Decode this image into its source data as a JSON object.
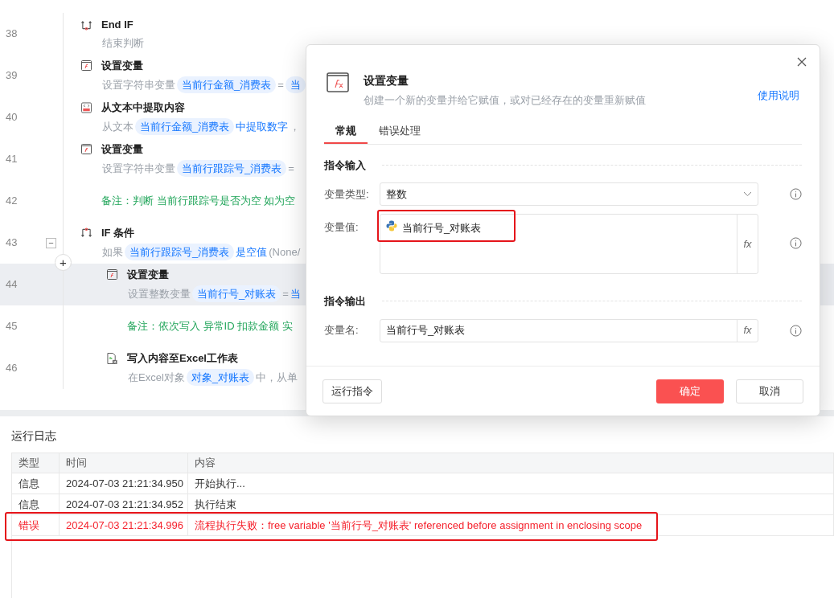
{
  "flow": {
    "add_button": "+",
    "steps": [
      {
        "line": "38",
        "kind": "endif",
        "title": "End IF",
        "selected": false,
        "desc": [
          {
            "kind": "plain",
            "text": "结束判断"
          }
        ]
      },
      {
        "line": "39",
        "kind": "setvar",
        "title": "设置变量",
        "selected": false,
        "desc": [
          {
            "kind": "plain",
            "text": "设置字符串变量"
          },
          {
            "kind": "var",
            "text": "当前行金额_消费表"
          },
          {
            "kind": "plain",
            "text": "="
          },
          {
            "kind": "var",
            "text": "当"
          }
        ]
      },
      {
        "line": "40",
        "kind": "extract",
        "title": "从文本中提取内容",
        "selected": false,
        "desc": [
          {
            "kind": "plain",
            "text": "从文本"
          },
          {
            "kind": "var",
            "text": "当前行金额_消费表"
          },
          {
            "kind": "keyword",
            "text": "中提取数字"
          },
          {
            "kind": "plain",
            "text": "，"
          }
        ]
      },
      {
        "line": "41",
        "kind": "setvar",
        "title": "设置变量",
        "selected": false,
        "desc": [
          {
            "kind": "plain",
            "text": "设置字符串变量"
          },
          {
            "kind": "var",
            "text": "当前行跟踪号_消费表"
          },
          {
            "kind": "plain",
            "text": "="
          }
        ]
      },
      {
        "line": "42",
        "kind": "comment",
        "title": "备注：判断 当前行跟踪号是否为空 如为空",
        "selected": false
      },
      {
        "line": "43",
        "kind": "if",
        "title": "IF 条件",
        "selected": false,
        "expanded": true,
        "collapse_button": "−",
        "desc": [
          {
            "kind": "plain",
            "text": "如果"
          },
          {
            "kind": "var",
            "text": "当前行跟踪号_消费表"
          },
          {
            "kind": "keyword",
            "text": "是空值"
          },
          {
            "kind": "plain",
            "text": "(None/"
          }
        ],
        "children": [
          {
            "line": "44",
            "kind": "setvar",
            "title": "设置变量",
            "selected": true,
            "desc": [
              {
                "kind": "plain",
                "text": "设置整数变量"
              },
              {
                "kind": "var",
                "text": "当前行号_对账表"
              },
              {
                "kind": "plain",
                "text": "="
              },
              {
                "kind": "keyword",
                "text": "当"
              }
            ]
          },
          {
            "line": "45",
            "kind": "comment",
            "title": "备注：依次写入 异常ID 扣款金额 实",
            "selected": false
          },
          {
            "line": "46",
            "kind": "excel",
            "title": "写入内容至Excel工作表",
            "selected": false,
            "desc": [
              {
                "kind": "plain",
                "text": "在Excel对象"
              },
              {
                "kind": "var",
                "text": "对象_对账表"
              },
              {
                "kind": "plain",
                "text": "中，从单"
              }
            ]
          }
        ]
      }
    ]
  },
  "dialog": {
    "title": "设置变量",
    "subtitle": "创建一个新的变量并给它赋值，或对已经存在的变量重新赋值",
    "help_link": "使用说明",
    "tabs": [
      {
        "label": "常规",
        "selected": true
      },
      {
        "label": "错误处理",
        "selected": false
      }
    ],
    "input_section": "指令输入",
    "type_label": "变量类型:",
    "type_value": "整数",
    "value_label": "变量值:",
    "value_token": "当前行号_对账表",
    "value_highlighted": true,
    "output_section": "指令输出",
    "name_label": "变量名:",
    "name_value": "当前行号_对账表",
    "fx_buttons": [
      "fx",
      "fx"
    ],
    "run_button": "运行指令",
    "ok_button": "确定",
    "cancel_button": "取消"
  },
  "log": {
    "title": "运行日志",
    "columns": [
      "类型",
      "时间",
      "内容"
    ],
    "rows": [
      {
        "type": "信息",
        "time": "2024-07-03 21:21:34.950",
        "content": "开始执行...",
        "error": false,
        "highlighted": false
      },
      {
        "type": "信息",
        "time": "2024-07-03 21:21:34.952",
        "content": "执行结束",
        "error": false,
        "highlighted": false
      },
      {
        "type": "错误",
        "time": "2024-07-03 21:21:34.996",
        "content": "流程执行失败：free variable '当前行号_对账表' referenced before assignment in enclosing scope",
        "error": true,
        "highlighted": true
      }
    ]
  }
}
